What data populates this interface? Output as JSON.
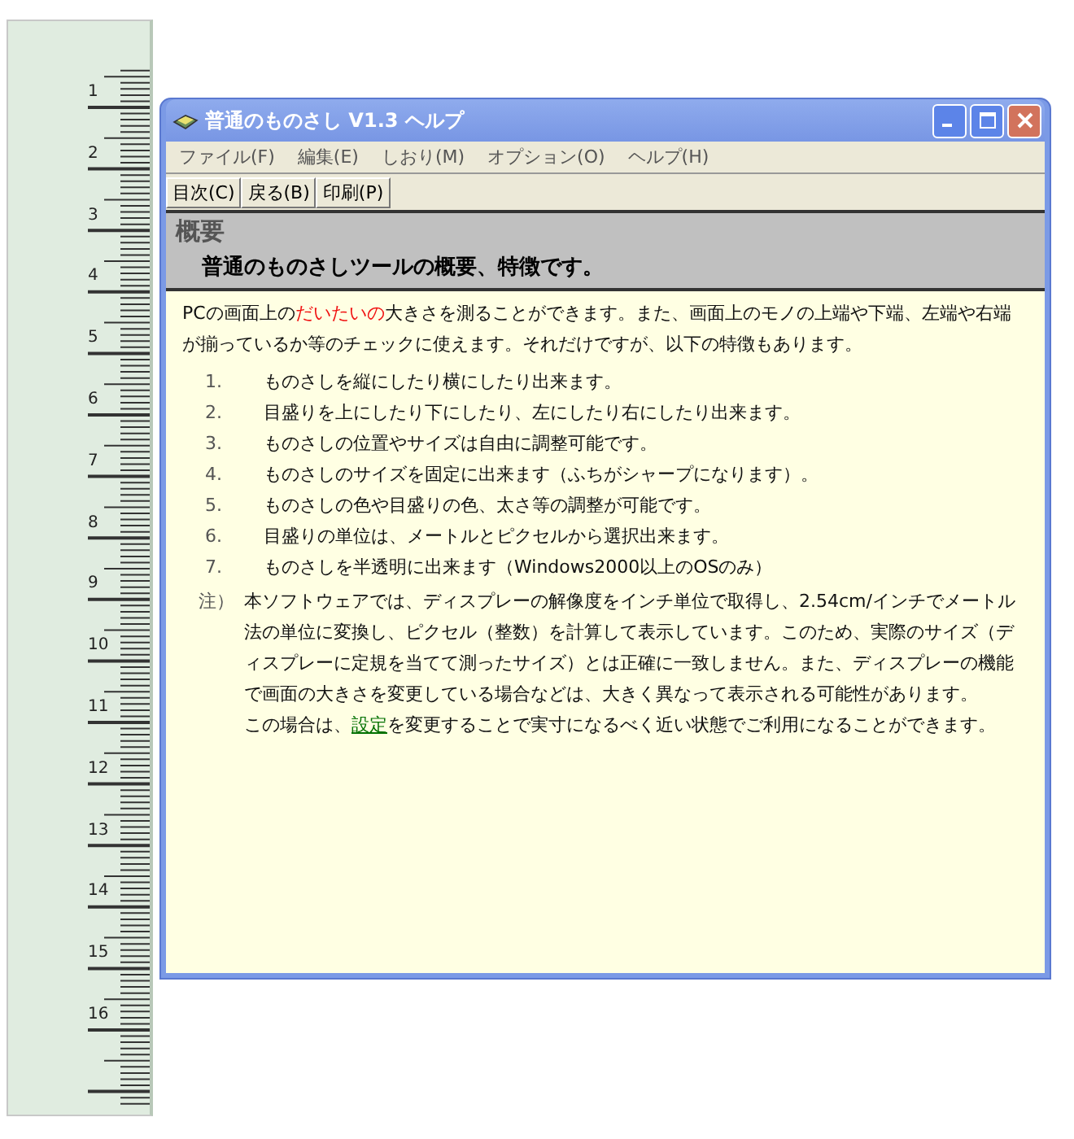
{
  "ruler": {
    "labels": [
      "1",
      "2",
      "3",
      "4",
      "5",
      "6",
      "7",
      "8",
      "9",
      "10",
      "11",
      "12",
      "13",
      "14",
      "15",
      "16"
    ]
  },
  "window": {
    "title": "普通のものさし V1.3 ヘルプ"
  },
  "menu": [
    "ファイル(F)",
    "編集(E)",
    "しおり(M)",
    "オプション(O)",
    "ヘルプ(H)"
  ],
  "toolbar": [
    "目次(C)",
    "戻る(B)",
    "印刷(P)"
  ],
  "heading": {
    "title": "概要",
    "subtitle": "普通のものさしツールの概要、特徴です。"
  },
  "intro": [
    {
      "kind": "text",
      "text": "PCの画面上の"
    },
    {
      "kind": "highlight",
      "text": "だいたいの"
    },
    {
      "kind": "text",
      "text": "大きさを測ることができます。また、画面上のモノの上端や下端、左端や右端が揃っているか等のチェックに使えます。それだけですが、以下の特徴もあります。"
    }
  ],
  "features": [
    {
      "number": "1.",
      "text": "ものさしを縦にしたり横にしたり出来ます。"
    },
    {
      "number": "2.",
      "text": "目盛りを上にしたり下にしたり、左にしたり右にしたり出来ます。"
    },
    {
      "number": "3.",
      "text": "ものさしの位置やサイズは自由に調整可能です。"
    },
    {
      "number": "4.",
      "text": "ものさしのサイズを固定に出来ます（ふちがシャープになります）。"
    },
    {
      "number": "5.",
      "text": "ものさしの色や目盛りの色、太さ等の調整が可能です。"
    },
    {
      "number": "6.",
      "text": "目盛りの単位は、メートルとピクセルから選択出来ます。"
    },
    {
      "number": "7.",
      "text": "ものさしを半透明に出来ます（Windows2000以上のOSのみ）"
    }
  ],
  "note": {
    "marker": "注）",
    "text": "本ソフトウェアでは、ディスプレーの解像度をインチ単位で取得し、2.54cm/インチでメートル法の単位に変換し、ピクセル（整数）を計算して表示しています。このため、実際のサイズ（ディスプレーに定規を当てて測ったサイズ）とは正確に一致しません。また、ディスプレーの機能で画面の大きさを変更している場合などは、大きく異なって表示される可能性があります。"
  },
  "closing": [
    {
      "kind": "text",
      "text": "この場合は、"
    },
    {
      "kind": "link",
      "text": "設定"
    },
    {
      "kind": "text",
      "text": "を変更することで実寸になるべく近い状態でご利用になることができます。"
    }
  ]
}
